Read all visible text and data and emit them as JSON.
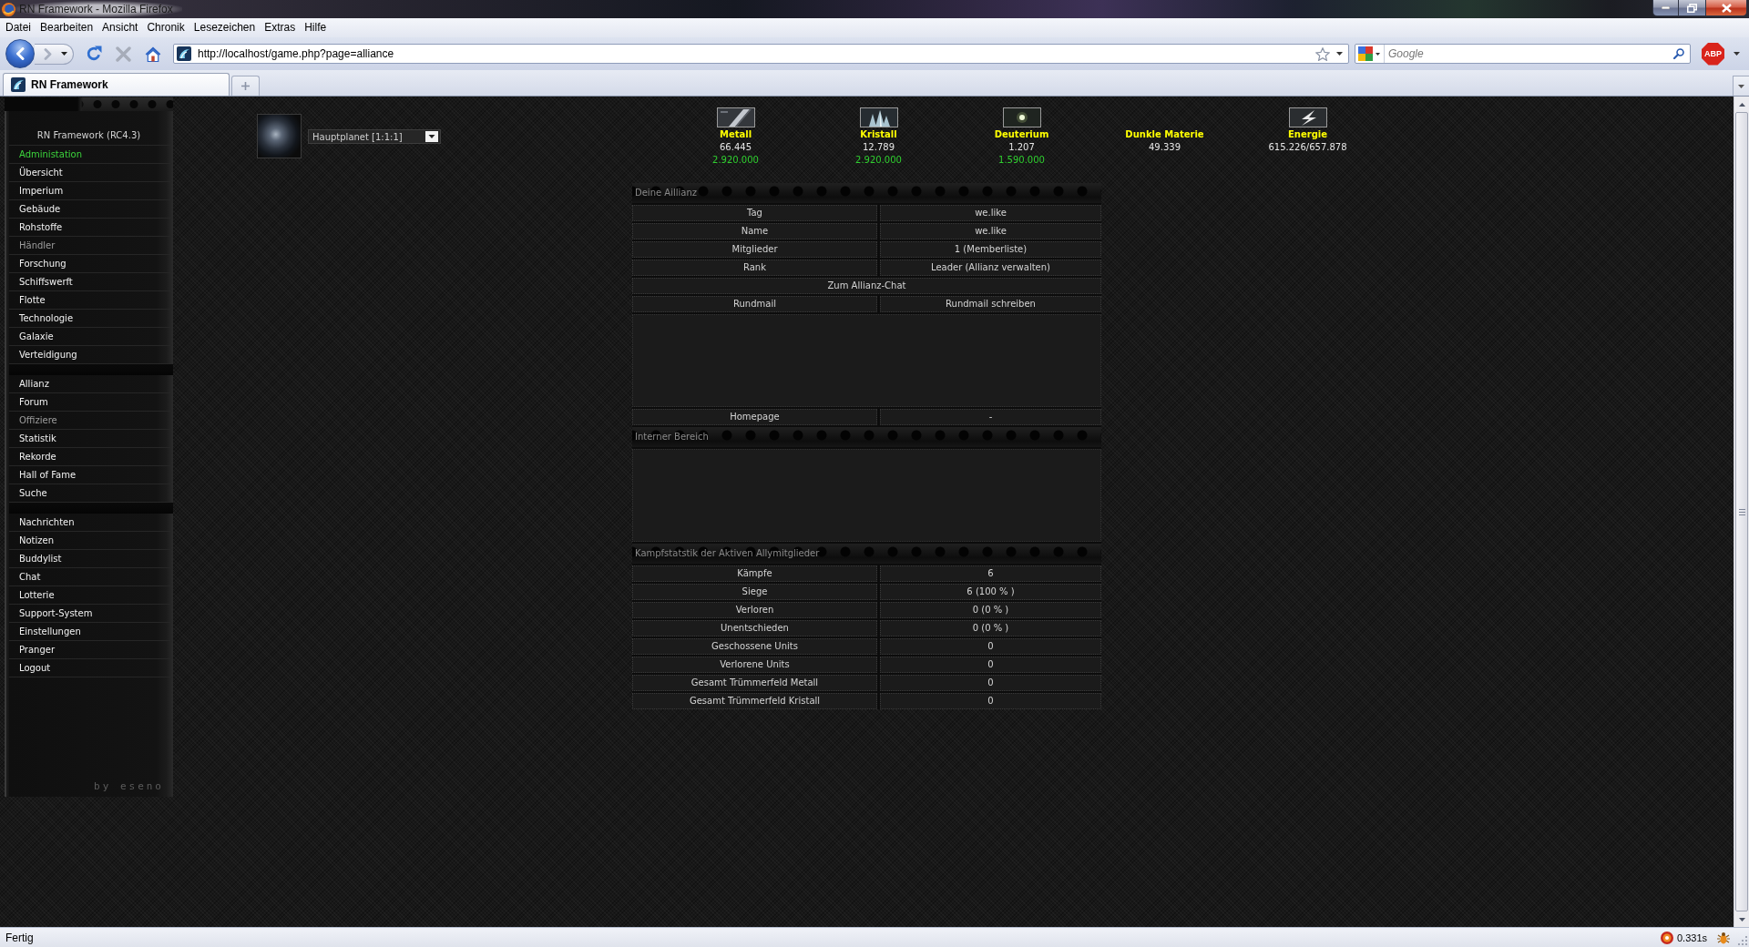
{
  "window": {
    "title": "RN Framework - Mozilla Firefox"
  },
  "menu": [
    "Datei",
    "Bearbeiten",
    "Ansicht",
    "Chronik",
    "Lesezeichen",
    "Extras",
    "Hilfe"
  ],
  "navigation": {
    "buttons": [
      {
        "kind": "back",
        "disabled": false
      },
      {
        "kind": "forward",
        "disabled": true
      },
      {
        "kind": "reload",
        "disabled": false
      },
      {
        "kind": "stop",
        "disabled": true
      },
      {
        "kind": "home",
        "disabled": false
      }
    ],
    "url": "http://localhost/game.php?page=alliance",
    "search": {
      "placeholder": "Google"
    },
    "addon": {
      "label": "ABP"
    }
  },
  "tabs": [
    {
      "label": "RN Framework",
      "selected": true
    }
  ],
  "sidebar": {
    "title": "RN Framework (RC4.3)",
    "groups": [
      {
        "items": [
          {
            "label": "Administation",
            "kind": "admin",
            "disabled": false
          },
          {
            "label": "Übersicht",
            "kind": "link",
            "disabled": false
          },
          {
            "label": "Imperium",
            "kind": "link",
            "disabled": false
          },
          {
            "label": "Gebäude",
            "kind": "link",
            "disabled": false
          },
          {
            "label": "Rohstoffe",
            "kind": "link",
            "disabled": false
          },
          {
            "label": "Händler",
            "kind": "link",
            "disabled": true
          },
          {
            "label": "Forschung",
            "kind": "link",
            "disabled": false
          },
          {
            "label": "Schiffswerft",
            "kind": "link",
            "disabled": false
          },
          {
            "label": "Flotte",
            "kind": "link",
            "disabled": false
          },
          {
            "label": "Technologie",
            "kind": "link",
            "disabled": false
          },
          {
            "label": "Galaxie",
            "kind": "link",
            "disabled": false
          },
          {
            "label": "Verteidigung",
            "kind": "link",
            "disabled": false
          }
        ]
      },
      {
        "items": [
          {
            "label": "Allianz",
            "kind": "link",
            "disabled": false
          },
          {
            "label": "Forum",
            "kind": "link",
            "disabled": false
          },
          {
            "label": "Offiziere",
            "kind": "link",
            "disabled": true
          },
          {
            "label": "Statistik",
            "kind": "link",
            "disabled": false
          },
          {
            "label": "Rekorde",
            "kind": "link",
            "disabled": false
          },
          {
            "label": "Hall of Fame",
            "kind": "link",
            "disabled": false
          },
          {
            "label": "Suche",
            "kind": "link",
            "disabled": false
          }
        ]
      },
      {
        "items": [
          {
            "label": "Nachrichten",
            "kind": "link",
            "disabled": false
          },
          {
            "label": "Notizen",
            "kind": "link",
            "disabled": false
          },
          {
            "label": "Buddylist",
            "kind": "link",
            "disabled": false
          },
          {
            "label": "Chat",
            "kind": "link",
            "disabled": false
          },
          {
            "label": "Lotterie",
            "kind": "link",
            "disabled": false
          },
          {
            "label": "Support-System",
            "kind": "link",
            "disabled": false
          },
          {
            "label": "Einstellungen",
            "kind": "link",
            "disabled": false
          },
          {
            "label": "Pranger",
            "kind": "link",
            "disabled": false
          },
          {
            "label": "Logout",
            "kind": "link",
            "disabled": false
          }
        ]
      }
    ],
    "footer": "by eseno"
  },
  "planet_select": {
    "value": "Hauptplanet [1:1:1]"
  },
  "resources": [
    {
      "kind": "metal",
      "name": "Metall",
      "amount": "66.445",
      "production": "2.920.000"
    },
    {
      "kind": "crystal",
      "name": "Kristall",
      "amount": "12.789",
      "production": "2.920.000"
    },
    {
      "kind": "deuterium",
      "name": "Deuterium",
      "amount": "1.207",
      "production": "1.590.000"
    },
    {
      "kind": "darkmatter",
      "name": "Dunkle Materie",
      "amount": "49.339"
    },
    {
      "kind": "energy",
      "name": "Energie",
      "amount": "615.226/657.878"
    }
  ],
  "sections": [
    {
      "title": "Deine Aillianz",
      "rows": [
        {
          "kind": "pair",
          "label": "Tag",
          "value": "we.like"
        },
        {
          "kind": "pair",
          "label": "Name",
          "value": "we.like"
        },
        {
          "kind": "pair",
          "label": "Mitglieder",
          "value": "1 (Memberliste)"
        },
        {
          "kind": "pair",
          "label": "Rank",
          "value": "Leader (Allianz verwalten)"
        },
        {
          "kind": "wide",
          "label": "Zum Allianz-Chat"
        },
        {
          "kind": "pair",
          "label": "Rundmail",
          "value": "Rundmail schreiben"
        },
        {
          "kind": "blank"
        },
        {
          "kind": "pair",
          "label": "Homepage",
          "value": "-"
        }
      ]
    },
    {
      "title": "Interner Bereich",
      "rows": [
        {
          "kind": "blank"
        }
      ]
    },
    {
      "title": "Kampfstatstik der Aktiven Allymitglieder",
      "rows": [
        {
          "kind": "pair",
          "label": "Kämpfe",
          "value": "6"
        },
        {
          "kind": "pair",
          "label": "Siege",
          "value": "6 (100 % )"
        },
        {
          "kind": "pair",
          "label": "Verloren",
          "value": "0 (0 % )"
        },
        {
          "kind": "pair",
          "label": "Unentschieden",
          "value": "0 (0 % )"
        },
        {
          "kind": "pair",
          "label": "Geschossene Units",
          "value": "0"
        },
        {
          "kind": "pair",
          "label": "Verlorene Units",
          "value": "0"
        },
        {
          "kind": "pair",
          "label": "Gesamt Trümmerfeld Metall",
          "value": "0"
        },
        {
          "kind": "pair",
          "label": "Gesamt Trümmerfeld Kristall",
          "value": "0"
        }
      ]
    }
  ],
  "status_bar": {
    "text": "Fertig",
    "timing": "0.331s"
  }
}
